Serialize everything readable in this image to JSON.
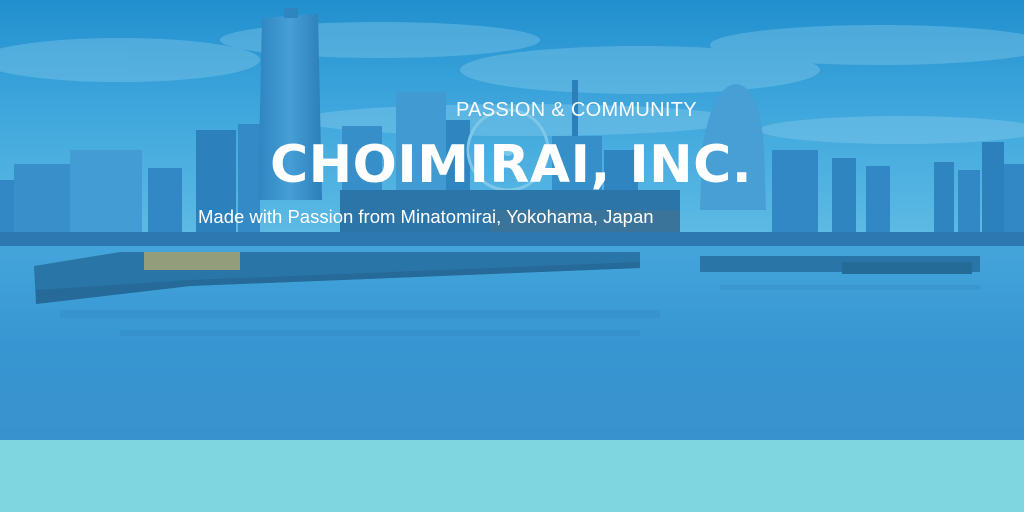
{
  "banner": {
    "tagline": "PASSION & COMMUNITY",
    "headline": "CHOIMIRAI, INC.",
    "subline": "Made with Passion from Minatomirai, Yokohama, Japan"
  },
  "colors": {
    "overlay_tint": "#2f9fd8",
    "sky_top": "#1d8bcc",
    "water": "#3a96d2",
    "bottom_strip": "#7fd6e0",
    "text": "#ffffff"
  }
}
